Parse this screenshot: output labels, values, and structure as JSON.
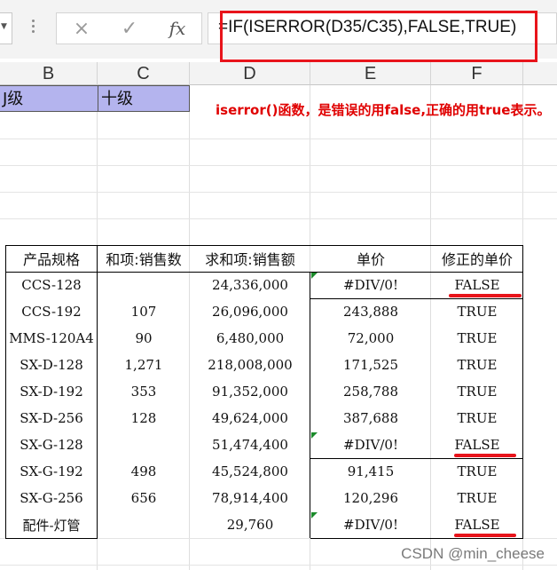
{
  "formula_bar": {
    "namebox_dropdown": "▼",
    "cancel_icon": "×",
    "enter_icon": "✓",
    "fx_label": "fx",
    "formula": "=IF(ISERROR(D35/C35),FALSE,TRUE)"
  },
  "column_headers": [
    "B",
    "C",
    "D",
    "E",
    "F"
  ],
  "top_cells": {
    "b1": "J级",
    "c1": "十级"
  },
  "note": "iserror()函数，是错误的用false,正确的用true表示。",
  "table": {
    "headers": [
      "产品规格",
      "和项:销售数",
      "求和项:销售额",
      "单价",
      "修正的单价"
    ],
    "rows": [
      {
        "spec": "CCS-128",
        "qty": "",
        "sales": "24,336,000",
        "price": "#DIV/0!",
        "fixed": "FALSE"
      },
      {
        "spec": "CCS-192",
        "qty": "107",
        "sales": "26,096,000",
        "price": "243,888",
        "fixed": "TRUE"
      },
      {
        "spec": "MMS-120A4",
        "qty": "90",
        "sales": "6,480,000",
        "price": "72,000",
        "fixed": "TRUE"
      },
      {
        "spec": "SX-D-128",
        "qty": "1,271",
        "sales": "218,008,000",
        "price": "171,525",
        "fixed": "TRUE"
      },
      {
        "spec": "SX-D-192",
        "qty": "353",
        "sales": "91,352,000",
        "price": "258,788",
        "fixed": "TRUE"
      },
      {
        "spec": "SX-D-256",
        "qty": "128",
        "sales": "49,624,000",
        "price": "387,688",
        "fixed": "TRUE"
      },
      {
        "spec": "SX-G-128",
        "qty": "",
        "sales": "51,474,400",
        "price": "#DIV/0!",
        "fixed": "FALSE"
      },
      {
        "spec": "SX-G-192",
        "qty": "498",
        "sales": "45,524,800",
        "price": "91,415",
        "fixed": "TRUE"
      },
      {
        "spec": "SX-G-256",
        "qty": "656",
        "sales": "78,914,400",
        "price": "120,296",
        "fixed": "TRUE"
      },
      {
        "spec": "配件-灯管",
        "qty": "",
        "sales": "29,760",
        "price": "#DIV/0!",
        "fixed": "FALSE"
      }
    ]
  },
  "watermark": "CSDN @min_cheese",
  "colors": {
    "highlight_red": "#e8141b",
    "purple_fill": "#b4b4ee",
    "note_red": "#e00000",
    "error_triangle": "#1a8a2a"
  }
}
